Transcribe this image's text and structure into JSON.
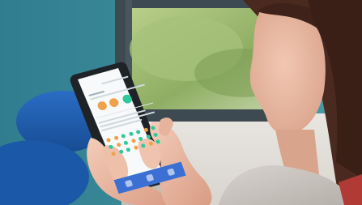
{
  "scene": {
    "description_colors": {
      "window_frame": "#3d4a52",
      "window_glass": "#9cb870",
      "wall_teal": "#3b8a9a",
      "chair_blue": "#1f5fb3",
      "phone_body": "#1e2328",
      "skin": "#e8b9a2",
      "hair": "#4a2a1f",
      "sweater": "#c7c2bd",
      "app_accent_orange": "#f0a14b",
      "app_accent_green": "#2fc99a",
      "app_bar_blue": "#3b6fd4"
    }
  },
  "phone_screen": {
    "grid_dots": [
      [
        "#f0a14b",
        "#f0a14b",
        "#2fc99a",
        "#2fc99a",
        "#2fc99a",
        "#f0a14b",
        "#2fc99a"
      ],
      [
        "#2fc99a",
        "#f0a14b",
        "#2fc99a",
        "#f0a14b",
        "#2fc99a",
        "#2fc99a",
        "#2fc99a"
      ],
      [
        "#f0a14b",
        "#2fc99a",
        "#2fc99a",
        "#f0a14b",
        "#2fc99a",
        "#f0a14b",
        "#2fc99a"
      ]
    ]
  }
}
